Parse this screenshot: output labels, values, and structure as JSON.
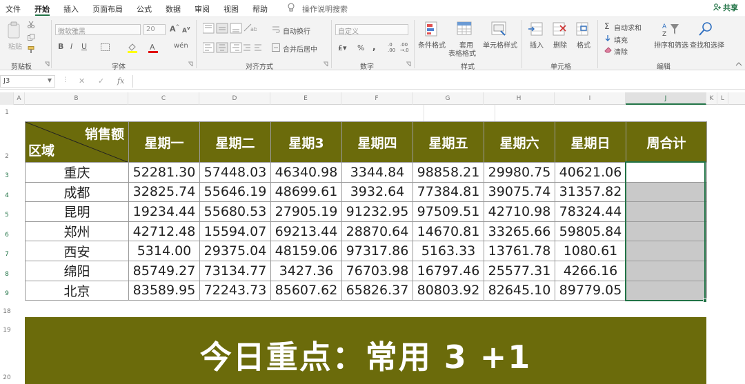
{
  "menu": {
    "items": [
      "文件",
      "开始",
      "插入",
      "页面布局",
      "公式",
      "数据",
      "审阅",
      "视图",
      "帮助"
    ],
    "active": "开始",
    "search_hint": "操作说明搜索",
    "share": "共享"
  },
  "ribbon": {
    "clipboard": {
      "paste": "粘贴",
      "label": "剪贴板"
    },
    "font": {
      "family": "微软雅黑",
      "size": "20",
      "label": "字体"
    },
    "alignment": {
      "wrap": "自动换行",
      "merge": "合并后居中",
      "label": "对齐方式"
    },
    "number": {
      "format": "自定义",
      "label": "数字"
    },
    "styles": {
      "conditional": "条件格式",
      "table_line1": "套用",
      "table_line2": "表格格式",
      "cell_styles": "单元格样式",
      "label": "样式"
    },
    "cells": {
      "insert": "插入",
      "delete": "删除",
      "format": "格式",
      "label": "单元格"
    },
    "editing": {
      "autosum": "自动求和",
      "fill": "填充",
      "clear": "清除",
      "sort": "排序和筛选",
      "find": "查找和选择",
      "label": "编辑"
    }
  },
  "formula_bar": {
    "name_box": "J3",
    "fx": "fx",
    "value": ""
  },
  "sheet": {
    "columns": [
      "A",
      "B",
      "C",
      "D",
      "E",
      "F",
      "G",
      "H",
      "I",
      "J",
      "K",
      "L"
    ],
    "selected_column": "J",
    "row_numbers": [
      "1",
      "2",
      "3",
      "4",
      "5",
      "6",
      "7",
      "8",
      "9",
      "18",
      "19",
      "20"
    ],
    "selected_rows": [
      "3",
      "4",
      "5",
      "6",
      "7",
      "8",
      "9"
    ]
  },
  "table": {
    "corner_top": "销售额",
    "corner_bottom": "区域",
    "headers": [
      "星期一",
      "星期二",
      "星期3",
      "星期四",
      "星期五",
      "星期六",
      "星期日",
      "周合计"
    ],
    "rows": [
      {
        "region": "重庆",
        "values": [
          "52281.30",
          "57448.03",
          "46340.98",
          "3344.84",
          "98858.21",
          "29980.75",
          "40621.06"
        ]
      },
      {
        "region": "成都",
        "values": [
          "32825.74",
          "55646.19",
          "48699.61",
          "3932.64",
          "77384.81",
          "39075.74",
          "31357.82"
        ]
      },
      {
        "region": "昆明",
        "values": [
          "19234.44",
          "55680.53",
          "27905.19",
          "91232.95",
          "97509.51",
          "42710.98",
          "78324.44"
        ]
      },
      {
        "region": "郑州",
        "values": [
          "42712.48",
          "15594.07",
          "69213.44",
          "28870.64",
          "14670.81",
          "33265.66",
          "59805.84"
        ]
      },
      {
        "region": "西安",
        "values": [
          "5314.00",
          "29375.04",
          "48159.06",
          "97317.86",
          "5163.33",
          "13761.78",
          "1080.61"
        ]
      },
      {
        "region": "绵阳",
        "values": [
          "85749.27",
          "73134.77",
          "3427.36",
          "76703.98",
          "16797.46",
          "25577.31",
          "4266.16"
        ]
      },
      {
        "region": "北京",
        "values": [
          "83589.95",
          "72243.73",
          "85607.62",
          "65826.37",
          "80803.92",
          "82645.10",
          "89779.05"
        ]
      }
    ]
  },
  "banner": {
    "text": "今日重点：常用 3 +1"
  },
  "colors": {
    "header_bg": "#6b6b0b",
    "accent": "#217346",
    "selection_fill": "#c9c9c9"
  }
}
